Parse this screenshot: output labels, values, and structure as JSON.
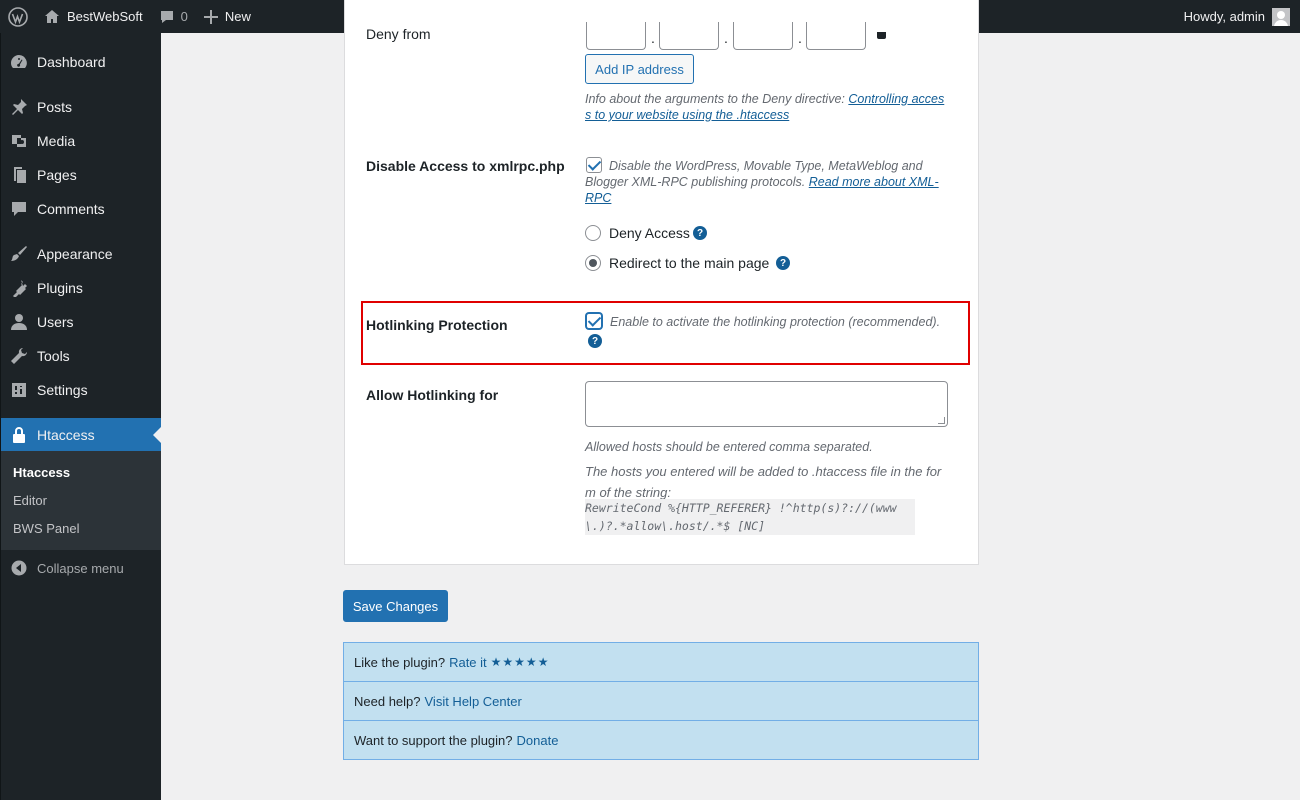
{
  "adminbar": {
    "site_name": "BestWebSoft",
    "comments_count": "0",
    "new_label": "New",
    "greeting": "Howdy, admin"
  },
  "sidebar": {
    "items": [
      {
        "label": "Dashboard",
        "icon": "dashboard-icon"
      },
      {
        "label": "Posts",
        "icon": "pin-icon"
      },
      {
        "label": "Media",
        "icon": "media-icon"
      },
      {
        "label": "Pages",
        "icon": "pages-icon"
      },
      {
        "label": "Comments",
        "icon": "comment-icon"
      },
      {
        "label": "Appearance",
        "icon": "brush-icon"
      },
      {
        "label": "Plugins",
        "icon": "plug-icon"
      },
      {
        "label": "Users",
        "icon": "user-icon"
      },
      {
        "label": "Tools",
        "icon": "wrench-icon"
      },
      {
        "label": "Settings",
        "icon": "sliders-icon"
      },
      {
        "label": "Htaccess",
        "icon": "lock-icon"
      }
    ],
    "submenu": [
      "Htaccess",
      "Editor",
      "BWS Panel"
    ],
    "collapse_label": "Collapse menu"
  },
  "settings": {
    "deny_from_label": "Deny from",
    "add_ip_button": "Add IP address",
    "deny_desc_text": "Info about the arguments to the Deny directive:",
    "deny_desc_link": "Controlling access to your website using the .htaccess",
    "xmlrpc_label": "Disable Access to xmlrpc.php",
    "xmlrpc_desc_text": "Disable the WordPress, Movable Type, MetaWeblog and Blogger XML-RPC publishing protocols.",
    "xmlrpc_desc_link": "Read more about XML-RPC",
    "deny_access_label": "Deny Access",
    "redirect_label": "Redirect to the main page",
    "hotlinking_label": "Hotlinking Protection",
    "hotlinking_desc": "Enable to activate the hotlinking protection (recommended).",
    "allow_hotlinking_label": "Allow Hotlinking for",
    "allow_desc_1": "Allowed hosts should be entered comma separated.",
    "allow_desc_2": "The hosts you entered will be added to .htaccess file in the form of the string:",
    "rewrite_code": " RewriteCond %{HTTP_REFERER} !^http(s)?://(www\\.)?.*allow\\.host/.*$ [NC]"
  },
  "save_button": "Save Changes",
  "info_panel": {
    "like_text": "Like the plugin?",
    "rate_link": "Rate it",
    "stars": "★★★★★",
    "help_text": "Need help?",
    "help_link": "Visit Help Center",
    "support_text": "Want to support the plugin?",
    "donate_link": "Donate"
  },
  "help_glyph": "?",
  "colors": {
    "accent": "#2271b1",
    "highlight_border": "#e00000",
    "info_bg": "#c2e0f0"
  }
}
